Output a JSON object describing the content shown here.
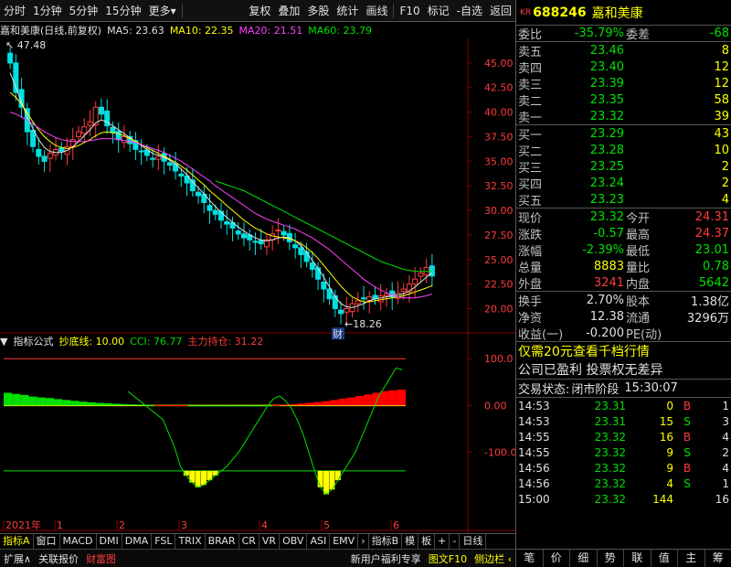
{
  "toolbar": {
    "items": [
      "分时",
      "1分钟",
      "5分钟",
      "15分钟",
      "更多",
      "复权",
      "叠加",
      "多股",
      "统计",
      "画线",
      "F10",
      "标记",
      "-自选",
      "返回"
    ]
  },
  "chart_legend": {
    "title": "嘉和美康(日线,前复权)",
    "ma5": "MA5: 23.63",
    "ma10": "MA10: 22.35",
    "ma20": "MA20: 21.51",
    "ma60": "MA60: 23.79",
    "colors": {
      "ma5": "#e0e0e0",
      "ma10": "#ffff00",
      "ma20": "#ff40ff",
      "ma60": "#00e000"
    }
  },
  "indicator_legend": {
    "name": "指标公式",
    "bottom_line": "抄底线: 10.00",
    "cci": "CCI: 76.77",
    "holding": "主力持仓: 31.22"
  },
  "chart_data": [
    {
      "type": "line",
      "title": "嘉和美康(日线,前复权)",
      "x_labels": [
        "2021年",
        "1",
        "2",
        "3",
        "4",
        "5",
        "6"
      ],
      "ylim": [
        18,
        47.5
      ],
      "y_ticks": [
        "45.00",
        "42.50",
        "40.00",
        "37.50",
        "35.00",
        "32.50",
        "30.00",
        "27.50",
        "25.00",
        "22.50",
        "20.00"
      ],
      "annotations": {
        "high": "47.48",
        "low": "18.26",
        "marker": "财"
      },
      "close": [
        45.0,
        42.0,
        40.5,
        38.0,
        36.5,
        35.5,
        35.0,
        35.8,
        36.2,
        36.0,
        36.5,
        37.2,
        38.0,
        38.5,
        39.0,
        40.5,
        39.8,
        38.6,
        37.9,
        37.2,
        37.5,
        36.8,
        36.2,
        36.0,
        35.6,
        35.2,
        35.5,
        35.0,
        34.6,
        34.0,
        33.5,
        32.8,
        32.0,
        31.5,
        30.8,
        30.0,
        29.6,
        29.0,
        28.6,
        28.2,
        27.6,
        27.2,
        27.0,
        26.8,
        26.6,
        27.0,
        27.6,
        28.0,
        27.5,
        26.8,
        26.2,
        25.5,
        24.8,
        24.0,
        23.0,
        22.0,
        21.0,
        20.0,
        19.5,
        20.0,
        20.5,
        20.8,
        21.0,
        21.2,
        21.0,
        21.3,
        21.5,
        21.2,
        21.6,
        22.0,
        22.5,
        23.0,
        23.6,
        24.2,
        23.32
      ],
      "series": [
        {
          "name": "MA5",
          "color": "#e0e0e0",
          "values": [
            44.0,
            42.5,
            41.0,
            39.5,
            38.3,
            37.2,
            36.4,
            36.0,
            35.9,
            35.9,
            36.1,
            36.5,
            37.0,
            37.6,
            38.2,
            38.9,
            39.2,
            39.0,
            38.6,
            38.2,
            37.8,
            37.4,
            37.0,
            36.6,
            36.2,
            35.8,
            35.6,
            35.4,
            35.1,
            34.7,
            34.2,
            33.6,
            32.9,
            32.3,
            31.7,
            31.0,
            30.4,
            29.8,
            29.3,
            28.8,
            28.3,
            27.9,
            27.5,
            27.2,
            27.0,
            26.9,
            27.0,
            27.2,
            27.3,
            27.2,
            26.9,
            26.4,
            25.7,
            24.9,
            24.1,
            23.2,
            22.2,
            21.2,
            20.5,
            20.2,
            20.1,
            20.3,
            20.5,
            20.8,
            21.0,
            21.1,
            21.2,
            21.3,
            21.4,
            21.5,
            21.8,
            22.2,
            22.7,
            23.2,
            23.63
          ]
        },
        {
          "name": "MA10",
          "color": "#ffff00",
          "values": [
            42.0,
            41.5,
            40.8,
            39.9,
            39.0,
            38.2,
            37.5,
            37.0,
            36.6,
            36.4,
            36.3,
            36.4,
            36.6,
            36.9,
            37.2,
            37.6,
            37.9,
            38.0,
            37.9,
            37.8,
            37.6,
            37.3,
            37.0,
            36.7,
            36.4,
            36.1,
            35.8,
            35.5,
            35.2,
            34.9,
            34.5,
            34.1,
            33.6,
            33.1,
            32.6,
            32.0,
            31.5,
            31.0,
            30.5,
            30.0,
            29.5,
            29.0,
            28.6,
            28.2,
            27.9,
            27.6,
            27.4,
            27.3,
            27.2,
            27.1,
            26.9,
            26.6,
            26.2,
            25.7,
            25.1,
            24.4,
            23.7,
            23.0,
            22.3,
            21.7,
            21.2,
            20.9,
            20.7,
            20.7,
            20.8,
            20.9,
            21.0,
            21.1,
            21.2,
            21.3,
            21.5,
            21.7,
            21.9,
            22.1,
            22.35
          ]
        },
        {
          "name": "MA20",
          "color": "#ff40ff",
          "values": [
            40.0,
            39.8,
            39.5,
            39.2,
            38.8,
            38.4,
            38.0,
            37.7,
            37.4,
            37.2,
            37.1,
            37.0,
            37.0,
            37.0,
            37.1,
            37.2,
            37.3,
            37.3,
            37.3,
            37.2,
            37.1,
            37.0,
            36.9,
            36.7,
            36.5,
            36.3,
            36.1,
            35.9,
            35.6,
            35.3,
            35.0,
            34.6,
            34.2,
            33.8,
            33.4,
            33.0,
            32.5,
            32.1,
            31.7,
            31.3,
            30.9,
            30.5,
            30.1,
            29.7,
            29.4,
            29.1,
            28.9,
            28.7,
            28.5,
            28.3,
            28.1,
            27.8,
            27.5,
            27.2,
            26.8,
            26.4,
            26.0,
            25.5,
            25.0,
            24.5,
            24.0,
            23.5,
            23.0,
            22.6,
            22.2,
            21.9,
            21.6,
            21.4,
            21.2,
            21.1,
            21.1,
            21.1,
            21.2,
            21.3,
            21.51
          ]
        },
        {
          "name": "MA60",
          "color": "#00e000",
          "start_index": 36,
          "values": [
            33.0,
            32.8,
            32.6,
            32.4,
            32.2,
            32.0,
            31.7,
            31.4,
            31.1,
            30.8,
            30.5,
            30.2,
            29.9,
            29.6,
            29.3,
            29.0,
            28.7,
            28.4,
            28.1,
            27.8,
            27.5,
            27.2,
            26.9,
            26.6,
            26.3,
            26.0,
            25.7,
            25.4,
            25.1,
            24.8,
            24.6,
            24.4,
            24.2,
            24.0,
            23.9,
            23.8,
            23.8,
            23.8,
            23.79
          ]
        }
      ]
    },
    {
      "type": "line",
      "ylim": [
        -240,
        120
      ],
      "y_ticks": [
        "100.0",
        "0.00",
        "-100.0"
      ],
      "cci": [
        30,
        20,
        10,
        0,
        -10,
        -20,
        -30,
        -60,
        -90,
        -130,
        -150,
        -165,
        -175,
        -170,
        -160,
        -150,
        -140,
        -130,
        -115,
        -100,
        -80,
        -60,
        -40,
        -20,
        0,
        15,
        20,
        10,
        -5,
        -30,
        -60,
        -100,
        -140,
        -175,
        -190,
        -180,
        -160,
        -140,
        -120,
        -100,
        -70,
        -40,
        -10,
        20,
        40,
        60,
        80,
        76.77
      ],
      "bottom_line": -140,
      "holding_bars": [
        60,
        55,
        50,
        42,
        38,
        35,
        30,
        26,
        22,
        18,
        15,
        12,
        10,
        8,
        6,
        5,
        4,
        3,
        2,
        2,
        1,
        1,
        0,
        -1,
        -2,
        -3,
        -4,
        -4,
        -3,
        -2,
        -1,
        0,
        2,
        4,
        6,
        9,
        12,
        16,
        20,
        26,
        32,
        38,
        45,
        52,
        60,
        68,
        72,
        75
      ]
    }
  ],
  "bottom_tabs": [
    "指标A",
    "窗口",
    "MACD",
    "DMI",
    "DMA",
    "FSL",
    "TRIX",
    "BRAR",
    "CR",
    "VR",
    "OBV",
    "ASI",
    "EMV",
    "›",
    "指标B",
    "模",
    "板",
    "+",
    "-",
    "日线"
  ],
  "status_bar": {
    "expand": "扩展∧",
    "related": "关联报价",
    "wealth": "财富图",
    "news": "新用户福利专享",
    "f10": "图文F10",
    "sidebar": "侧边栏 ‹"
  },
  "stock": {
    "market": "KR",
    "code": "688246",
    "name": "嘉和美康"
  },
  "orderbook": {
    "wei_bi_label": "委比",
    "wei_bi": "-35.79%",
    "wei_cha_label": "委差",
    "wei_cha": "-68",
    "asks": [
      {
        "label": "卖五",
        "price": "23.46",
        "vol": "8"
      },
      {
        "label": "卖四",
        "price": "23.40",
        "vol": "12"
      },
      {
        "label": "卖三",
        "price": "23.39",
        "vol": "12"
      },
      {
        "label": "卖二",
        "price": "23.35",
        "vol": "58"
      },
      {
        "label": "卖一",
        "price": "23.32",
        "vol": "39"
      }
    ],
    "bids": [
      {
        "label": "买一",
        "price": "23.29",
        "vol": "43"
      },
      {
        "label": "买二",
        "price": "23.28",
        "vol": "10"
      },
      {
        "label": "买三",
        "price": "23.25",
        "vol": "2"
      },
      {
        "label": "买四",
        "price": "23.24",
        "vol": "2"
      },
      {
        "label": "买五",
        "price": "23.23",
        "vol": "4"
      }
    ]
  },
  "quote": {
    "xj_label": "现价",
    "xj": "23.32",
    "jk_label": "今开",
    "jk": "24.31",
    "zd_label": "涨跌",
    "zd": "-0.57",
    "zg_label": "最高",
    "zg": "24.37",
    "zf_label": "涨幅",
    "zf": "-2.39%",
    "zdi_label": "最低",
    "zdi": "23.01",
    "zl_label": "总量",
    "zl": "8883",
    "lb_label": "量比",
    "lb": "0.78",
    "wp_label": "外盘",
    "wp": "3241",
    "np_label": "内盘",
    "np": "5642",
    "hs_label": "换手",
    "hs": "2.70%",
    "gb_label": "股本",
    "gb": "1.38亿",
    "jz_label": "净资",
    "jz": "12.38",
    "lt_label": "流通",
    "lt": "3296万",
    "sy_label": "收益(一)",
    "sy": "-0.200",
    "pe_label": "PE(动)",
    "pe": ""
  },
  "promo": {
    "line1": "仅需20元查看千档行情",
    "line2": "公司已盈利 投票权无差异"
  },
  "trade_status": {
    "label": "交易状态:",
    "value": "闭市阶段",
    "time": "15:30:07"
  },
  "ticks": [
    {
      "t": "14:53",
      "p": "23.31",
      "v": "0",
      "bs": "B",
      "c": "1"
    },
    {
      "t": "14:53",
      "p": "23.31",
      "v": "15",
      "bs": "S",
      "c": "3"
    },
    {
      "t": "14:55",
      "p": "23.32",
      "v": "16",
      "bs": "B",
      "c": "4"
    },
    {
      "t": "14:55",
      "p": "23.32",
      "v": "9",
      "bs": "S",
      "c": "2"
    },
    {
      "t": "14:56",
      "p": "23.32",
      "v": "9",
      "bs": "B",
      "c": "4"
    },
    {
      "t": "14:56",
      "p": "23.32",
      "v": "4",
      "bs": "S",
      "c": "1"
    },
    {
      "t": "15:00",
      "p": "23.32",
      "v": "144",
      "bs": "",
      "c": "16"
    }
  ],
  "right_tabs": [
    "笔",
    "价",
    "细",
    "势",
    "联",
    "值",
    "主",
    "筹"
  ]
}
